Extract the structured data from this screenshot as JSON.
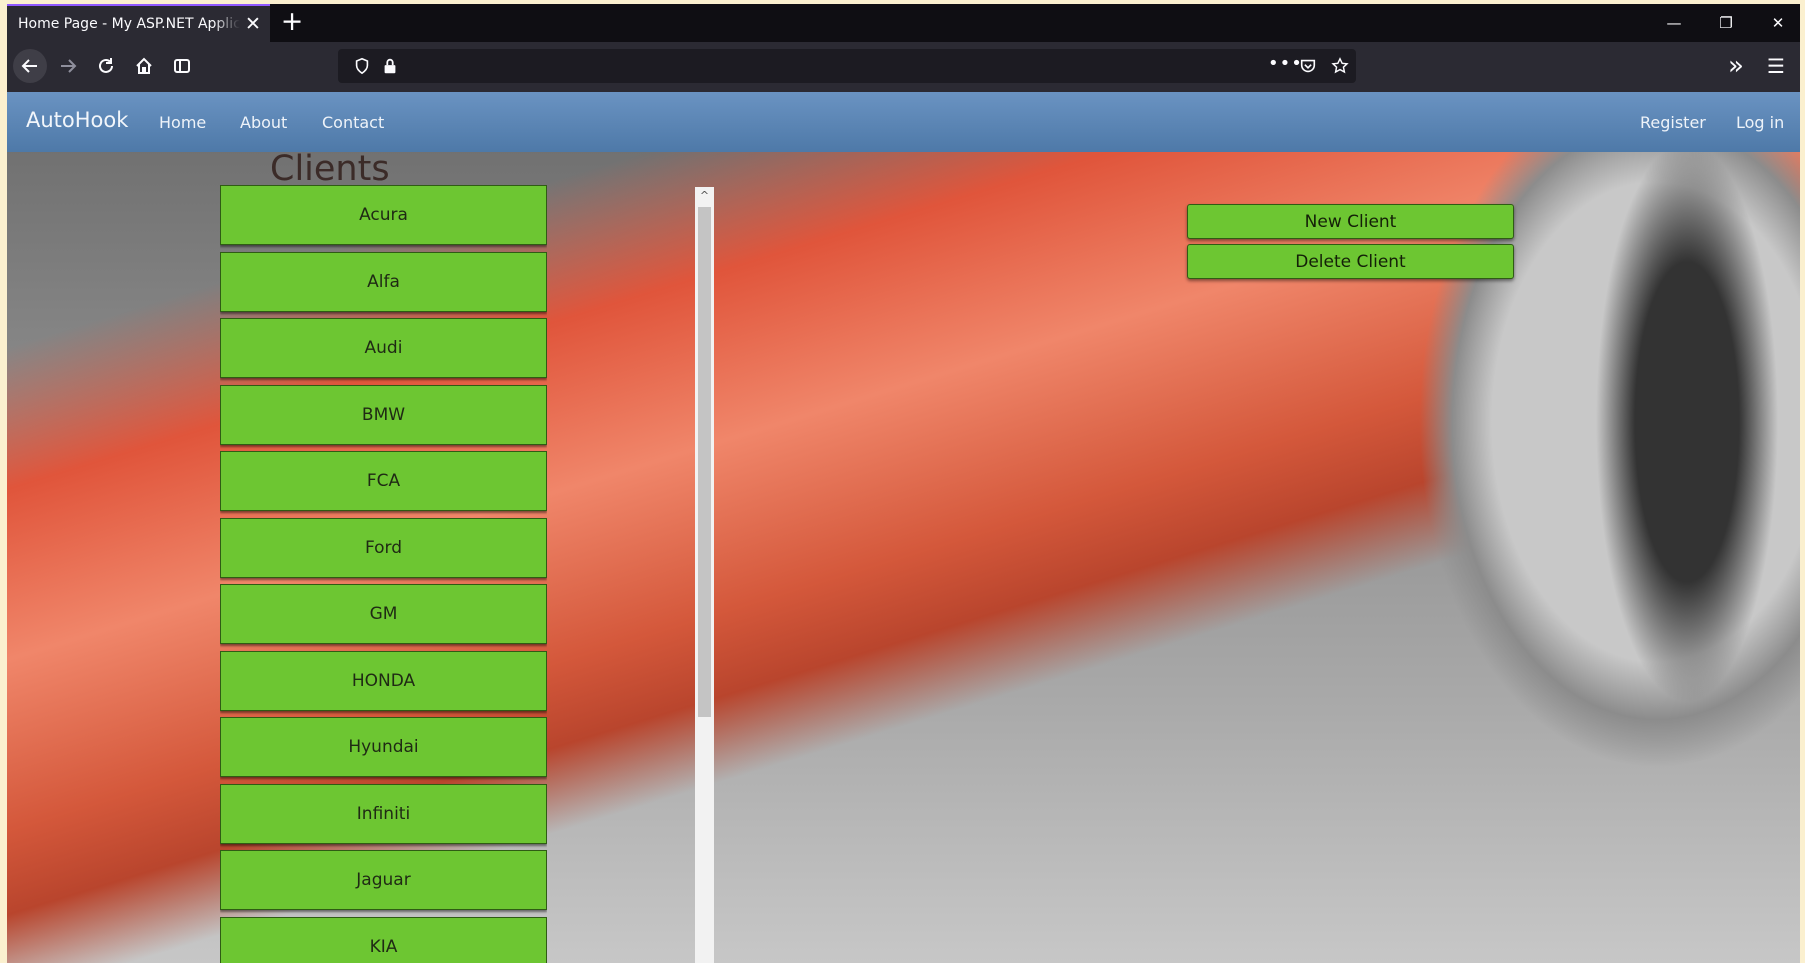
{
  "browser": {
    "tab_title": "Home Page - My ASP.NET Application",
    "tab_close_glyph": "✕",
    "new_tab_glyph": "+",
    "window_controls": [
      "—",
      "❐",
      "✕"
    ],
    "url_text": "",
    "page_actions_glyph": "•••",
    "overflow_glyph": "»",
    "menu_glyph": "☰"
  },
  "site": {
    "brand": "AutoHook",
    "nav": {
      "home": "Home",
      "about": "About",
      "contact": "Contact",
      "register": "Register",
      "login": "Log in"
    }
  },
  "main": {
    "title": "Clients",
    "clients": [
      "Acura",
      "Alfa",
      "Audi",
      "BMW",
      "FCA",
      "Ford",
      "GM",
      "HONDA",
      "Hyundai",
      "Infiniti",
      "Jaguar",
      "KIA"
    ],
    "scroll_up_glyph": "^",
    "new_client_label": "New Client",
    "delete_client_label": "Delete Client"
  },
  "colors": {
    "button_green": "#6dc632",
    "header_blue": "#5a86b8",
    "tab_accent": "#9059ff"
  },
  "icons": [
    "back-arrow-icon",
    "forward-arrow-icon",
    "reload-icon",
    "home-icon",
    "sidebar-icon",
    "shield-icon",
    "lock-icon",
    "pocket-icon",
    "star-icon"
  ]
}
